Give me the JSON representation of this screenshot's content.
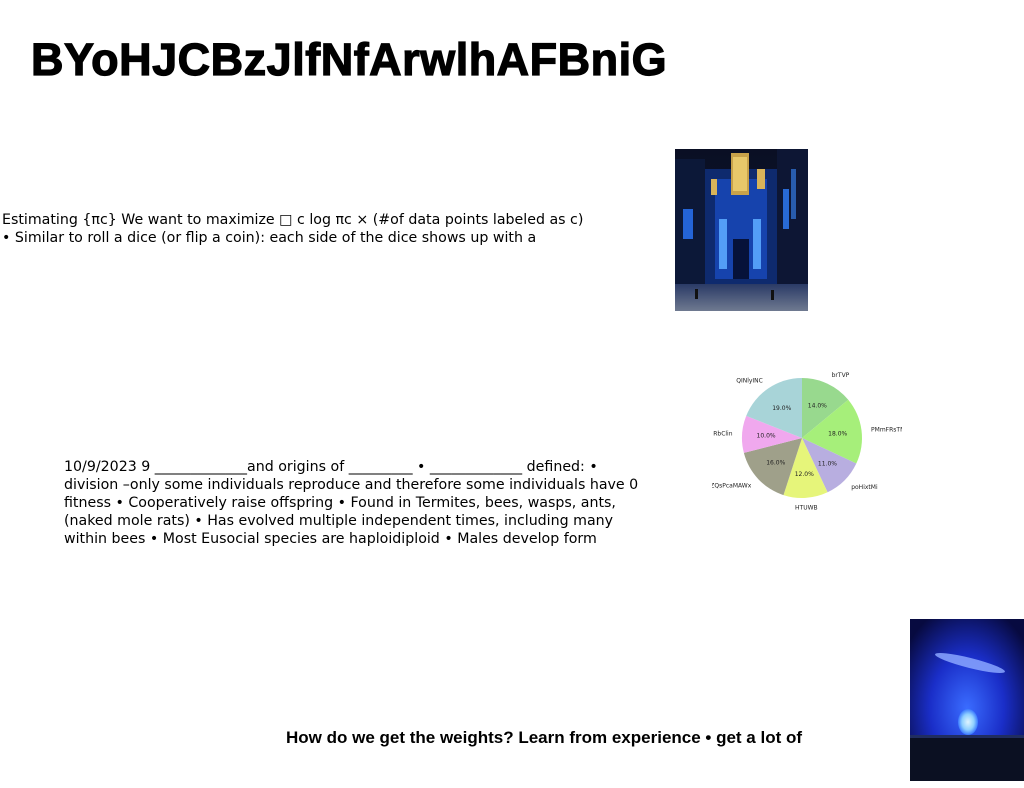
{
  "title": "BYoHJCBzJlfNfArwlhAFBniG",
  "text_blocks": {
    "estimating": "Estimating {πc} We want to maximize □ c log πc × (#of data points labeled as c)\n• Similar to roll a dice (or flip a coin): each side of the dice shows up with a",
    "eusocial": "10/9/2023 9 _____________and origins of _________ • _____________ defined: • division –only some individuals reproduce and therefore some individuals have 0 fitness • Cooperatively raise offspring • Found in Termites, bees, wasps, ants, (naked mole rats) • Has evolved multiple independent times, including many within bees • Most Eusocial species are haploidiploid • Males develop form",
    "weights": "How do we get the weights? Learn from experience • get a lot of"
  },
  "images": {
    "city": "blue-neon-city-street-photo",
    "lamp": "blue-glowing-lamp-photo"
  },
  "chart_data": {
    "type": "pie",
    "categories": [
      "brTVP",
      "PMmFRsTN",
      "poHixtMi",
      "HTUWB",
      "ZQsPcaMAWx",
      "RbClin",
      "QINlyINC"
    ],
    "values": [
      14.0,
      18.0,
      11.0,
      12.0,
      16.0,
      10.0,
      19.0
    ],
    "value_labels": [
      "14.0%",
      "18.0%",
      "11.0%",
      "12.0%",
      "16.0%",
      "10.0%",
      "19.0%"
    ],
    "colors": [
      "#98d98e",
      "#a6ef7a",
      "#b8aee0",
      "#e6f57a",
      "#9fa08a",
      "#f0a8ee",
      "#a8d4d8"
    ],
    "start_angle_deg": 90,
    "direction": "clockwise"
  }
}
